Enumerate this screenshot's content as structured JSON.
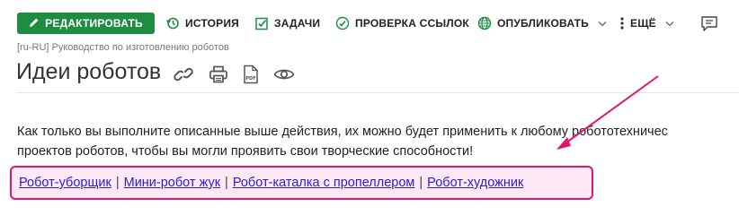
{
  "toolbar": {
    "edit_label": "РЕДАКТИРОВАТЬ",
    "history_label": "ИСТОРИЯ",
    "tasks_label": "ЗАДАЧИ",
    "check_links_label": "ПРОВЕРКА ССЫЛОК",
    "publish_label": "ОПУБЛИКОВАТЬ",
    "more_label": "ЕЩЁ"
  },
  "breadcrumb": "[ru-RU] Руководство по изготовлению роботов",
  "page": {
    "title": "Идеи роботов",
    "paragraph_line1": "Как только вы выполните описанные выше действия, их можно будет применить к любому робототехничес",
    "paragraph_line2": "проектов роботов, чтобы вы могли проявить свои творческие способности!"
  },
  "links": [
    {
      "label": "Робот-уборщик"
    },
    {
      "label": "Мини-робот жук"
    },
    {
      "label": "Робот-каталка с пропеллером"
    },
    {
      "label": "Робот-художник"
    }
  ],
  "link_separator": "|",
  "colors": {
    "edit_button": "#1e8c41",
    "highlight_border": "#e0156d",
    "highlight_fill": "#fde9f4",
    "link": "#2a1fd6"
  },
  "icons": [
    "pencil-icon",
    "history-icon",
    "checkbox-icon",
    "link-check-icon",
    "globe-icon",
    "more-vertical-icon",
    "comment-icon",
    "link-icon",
    "print-icon",
    "pdf-icon",
    "eye-icon",
    "annotation-arrow"
  ]
}
